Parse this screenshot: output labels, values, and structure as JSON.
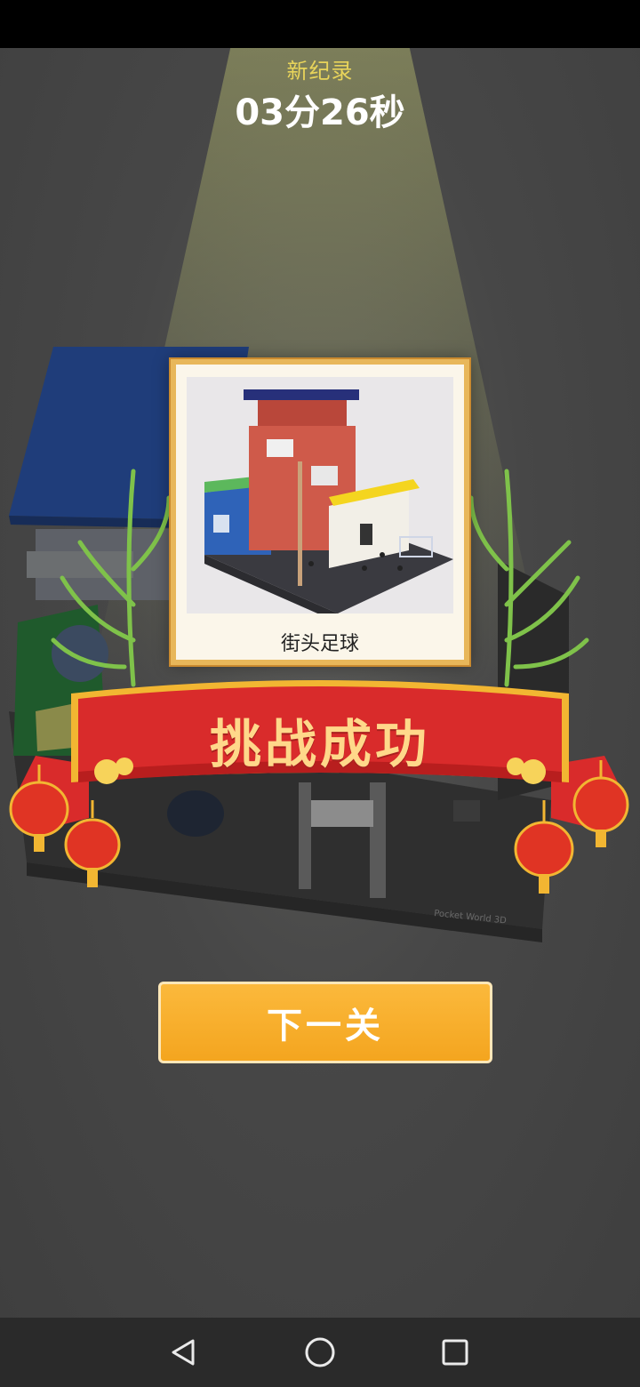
{
  "record": {
    "label": "新纪录",
    "time": "03分26秒"
  },
  "card": {
    "title": "街头足球"
  },
  "banner": {
    "text": "挑战成功"
  },
  "next_button": {
    "label": "下一关"
  },
  "watermark": "Pocket World 3D",
  "colors": {
    "button": "#f4a51f",
    "banner": "#d92b2b",
    "record_label": "#e8d45a",
    "card_frame": "#e8b75a"
  },
  "navigation": {
    "back": "back-icon",
    "home": "home-icon",
    "recents": "recents-icon"
  }
}
